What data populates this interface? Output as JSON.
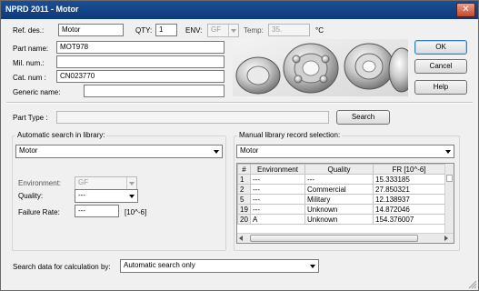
{
  "window": {
    "title": "NPRD 2011 - Motor",
    "close_glyph": "✕"
  },
  "header": {
    "ref_des_label": "Ref. des.:",
    "ref_des_value": "Motor",
    "qty_label": "QTY:",
    "qty_value": "1",
    "env_label": "ENV:",
    "env_value": "GF",
    "temp_label": "Temp:",
    "temp_value": "35.",
    "temp_unit": "°C",
    "part_name_label": "Part name:",
    "part_name_value": "MOT978",
    "mil_num_label": "Mil. num.:",
    "mil_num_value": "",
    "cat_num_label": "Cat. num :",
    "cat_num_value": "CN023770",
    "generic_name_label": "Generic name:",
    "generic_name_value": ""
  },
  "buttons": {
    "ok": "OK",
    "cancel": "Cancel",
    "help": "Help",
    "search": "Search"
  },
  "part_type": {
    "label": "Part Type :",
    "value": ""
  },
  "auto_search": {
    "title": "Automatic search in library:",
    "library_value": "Motor",
    "environment_label": "Environment:",
    "environment_value": "GF",
    "quality_label": "Quality:",
    "quality_value": "---",
    "failure_rate_label": "Failure Rate:",
    "failure_rate_value": "---",
    "failure_rate_unit": "[10^-6]"
  },
  "manual_selection": {
    "title": "Manual library record selection:",
    "library_value": "Motor",
    "columns": [
      "#",
      "Environment",
      "Quality",
      "FR [10^-6]"
    ],
    "rows": [
      {
        "num": "1",
        "env": "---",
        "quality": "---",
        "fr": "15.333185"
      },
      {
        "num": "2",
        "env": "---",
        "quality": "Commercial",
        "fr": "27.850321"
      },
      {
        "num": "5",
        "env": "---",
        "quality": "Military",
        "fr": "12.138937"
      },
      {
        "num": "19",
        "env": "---",
        "quality": "Unknown",
        "fr": "14.872046"
      },
      {
        "num": "20",
        "env": "A",
        "quality": "Unknown",
        "fr": "154.376007"
      }
    ]
  },
  "search_data": {
    "label": "Search data for calculation by:",
    "value": "Automatic search only"
  },
  "colors": {
    "title_bar": "#0c3a7c",
    "close_button": "#c2462d",
    "default_button_border": "#3c7fb1"
  },
  "icons": {
    "close": "close-icon",
    "dropdown": "chevron-down-icon",
    "bearing_image": "ball-bearing-image"
  }
}
